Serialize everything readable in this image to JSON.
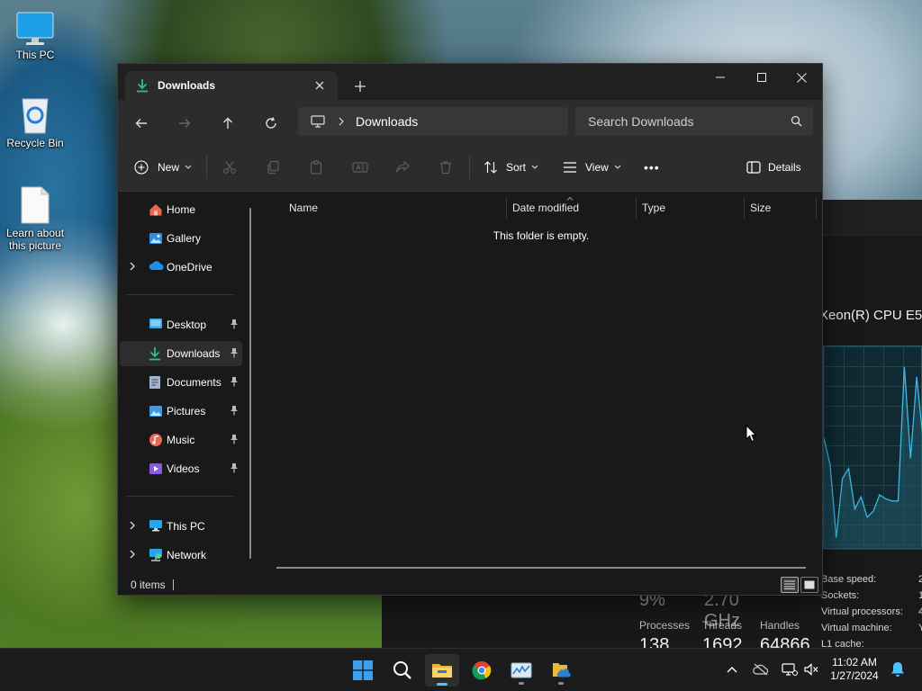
{
  "desktop": {
    "icons": [
      {
        "label": "This PC"
      },
      {
        "label": "Recycle Bin"
      },
      {
        "label": "Learn about this picture"
      }
    ]
  },
  "task_manager": {
    "cpu_name": "Xeon(R) CPU E5-",
    "utilization": "9%",
    "speed": "2.70 GHz",
    "stats": [
      {
        "label": "Processes",
        "value": "138"
      },
      {
        "label": "Threads",
        "value": "1692"
      },
      {
        "label": "Handles",
        "value": "64866"
      }
    ],
    "specs": [
      {
        "label": "Base speed:",
        "value": "2"
      },
      {
        "label": "Sockets:",
        "value": "1"
      },
      {
        "label": "Virtual processors:",
        "value": "4"
      },
      {
        "label": "Virtual machine:",
        "value": "Y"
      },
      {
        "label": "L1 cache:",
        "value": ""
      }
    ],
    "graph_values": [
      0.55,
      0.42,
      0.06,
      0.35,
      0.4,
      0.2,
      0.26,
      0.16,
      0.19,
      0.27,
      0.25,
      0.24,
      0.24,
      0.9,
      0.45,
      0.85,
      0.55
    ]
  },
  "explorer": {
    "tab_title": "Downloads",
    "window_controls": {
      "minimize": "–",
      "maximize": "☐",
      "close": "✕"
    },
    "breadcrumb": "Downloads",
    "search_placeholder": "Search Downloads",
    "commands": {
      "new": "New",
      "sort": "Sort",
      "view": "View",
      "more": "•••",
      "details": "Details"
    },
    "nav_items": [
      {
        "label": "Home",
        "icon": "home-icon",
        "pinned": false
      },
      {
        "label": "Gallery",
        "icon": "gallery-icon",
        "pinned": false
      },
      {
        "label": "OneDrive",
        "icon": "onedrive-icon",
        "pinned": false,
        "expandable": true
      },
      {
        "label": "Desktop",
        "icon": "desktop-folder-icon",
        "pinned": true
      },
      {
        "label": "Downloads",
        "icon": "downloads-folder-icon",
        "pinned": true,
        "selected": true
      },
      {
        "label": "Documents",
        "icon": "documents-folder-icon",
        "pinned": true
      },
      {
        "label": "Pictures",
        "icon": "pictures-folder-icon",
        "pinned": true
      },
      {
        "label": "Music",
        "icon": "music-folder-icon",
        "pinned": true
      },
      {
        "label": "Videos",
        "icon": "videos-folder-icon",
        "pinned": true
      },
      {
        "label": "This PC",
        "icon": "this-pc-icon",
        "pinned": false,
        "expandable": true
      },
      {
        "label": "Network",
        "icon": "network-icon",
        "pinned": false,
        "expandable": true
      }
    ],
    "columns": [
      "Name",
      "Date modified",
      "Type",
      "Size"
    ],
    "empty_message": "This folder is empty.",
    "status": "0 items"
  },
  "taskbar": {
    "apps": [
      "start-button",
      "search-button",
      "file-explorer",
      "chrome",
      "task-manager",
      "file-manager-pinned"
    ],
    "clock": {
      "time": "11:02 AM",
      "date": "1/27/2024"
    }
  },
  "colors": {
    "accent": "#4cc2ff",
    "download_green": "#2bbf8f",
    "window_bg": "#191919",
    "chrome_bg": "#2c2c2c"
  }
}
